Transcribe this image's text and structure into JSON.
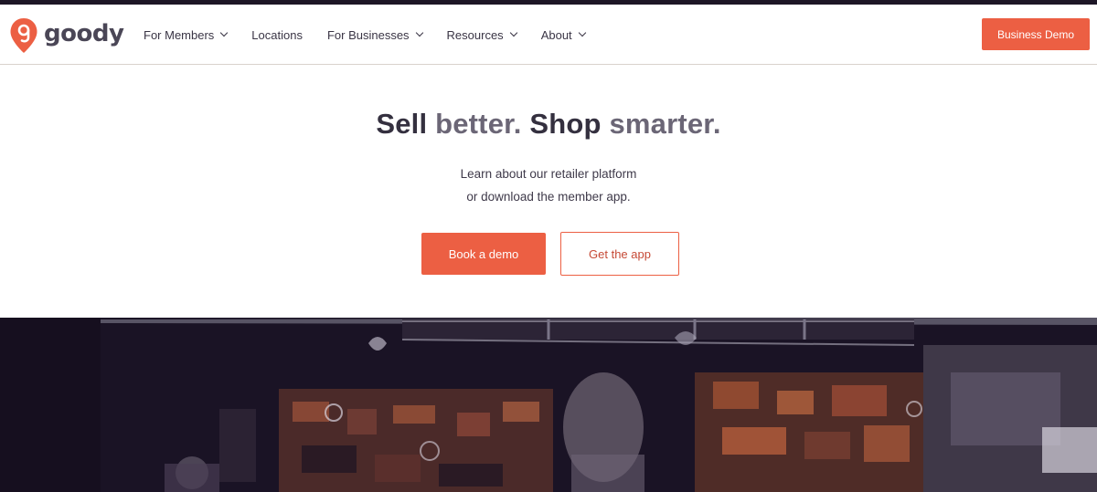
{
  "brand": {
    "name": "goody",
    "logo_icon": "location-pin-g-icon",
    "accent": "#ec5f43",
    "dark": "#1d1626"
  },
  "nav": {
    "items": [
      {
        "label": "For Members",
        "has_dropdown": true
      },
      {
        "label": "Locations",
        "has_dropdown": false
      },
      {
        "label": "For Businesses",
        "has_dropdown": true
      },
      {
        "label": "Resources",
        "has_dropdown": true
      },
      {
        "label": "About",
        "has_dropdown": true
      }
    ],
    "cta_label": "Business Demo"
  },
  "hero": {
    "headline": {
      "part1": "Sell",
      "part2": " better. ",
      "part3": "Shop",
      "part4": " smarter."
    },
    "subtitle_line1": "Learn about our retailer platform",
    "subtitle_line2": "or download the member app.",
    "primary_button": "Book a demo",
    "secondary_button": "Get the app"
  },
  "photo": {
    "icon": "store-interior-photo"
  }
}
